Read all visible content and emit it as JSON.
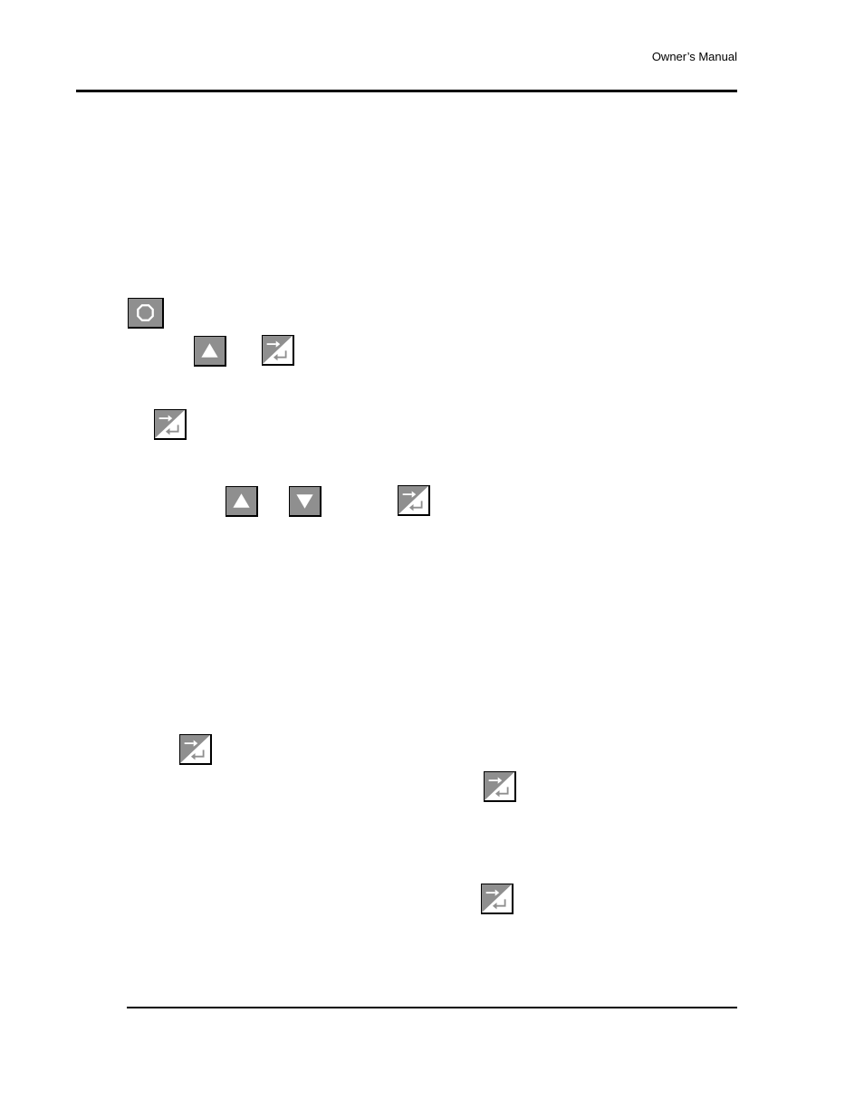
{
  "header": {
    "title": "Owner’s Manual"
  },
  "keys": [
    {
      "icon": "stop-icon"
    },
    {
      "icon": "up-arrow-icon"
    },
    {
      "icon": "enter-icon"
    },
    {
      "icon": "enter-icon"
    },
    {
      "icon": "up-arrow-icon"
    },
    {
      "icon": "down-arrow-icon"
    },
    {
      "icon": "enter-icon"
    },
    {
      "icon": "enter-icon"
    },
    {
      "icon": "enter-icon"
    },
    {
      "icon": "enter-icon"
    }
  ],
  "colors": {
    "key_gray": "#8f8f8f",
    "glyph": "#ffffff"
  }
}
